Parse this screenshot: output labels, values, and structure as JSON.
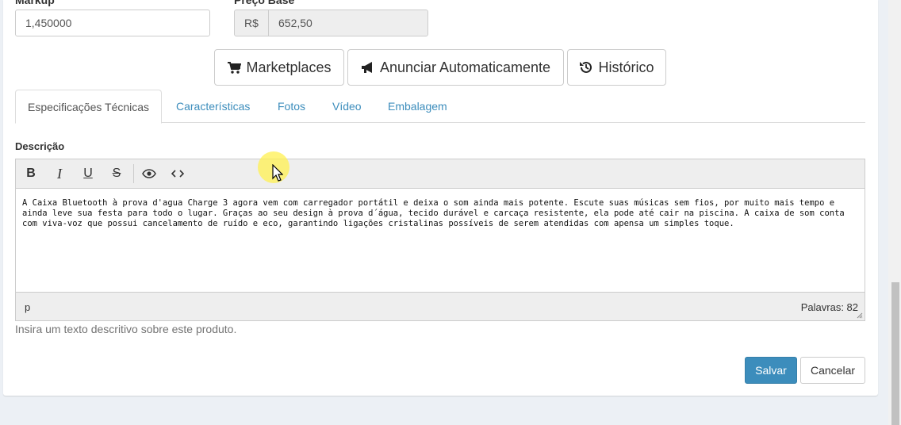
{
  "form": {
    "markup_label": "Markup",
    "markup_value": "1,450000",
    "base_price_label": "Preço Base",
    "currency": "R$",
    "base_price_value": "652,50"
  },
  "actions": {
    "marketplaces": "Marketplaces",
    "auto_advertise": "Anunciar Automaticamente",
    "history": "Histórico"
  },
  "tabs": [
    {
      "label": "Especificações Técnicas",
      "active": true
    },
    {
      "label": "Características",
      "active": false
    },
    {
      "label": "Fotos",
      "active": false
    },
    {
      "label": "Vídeo",
      "active": false
    },
    {
      "label": "Embalagem",
      "active": false
    }
  ],
  "description": {
    "label": "Descrição",
    "text": "A Caixa Bluetooth à prova d'agua Charge 3 agora vem com carregador portátil e deixa o som ainda mais potente. Escute suas músicas sem fios, por muito mais tempo e ainda leve sua festa para todo o lugar. Graças ao seu design à prova d´água, tecido durável e carcaça resistente, ela pode até cair na piscina. A caixa de som conta com viva-voz que possui cancelamento de ruído e eco, garantindo ligações cristalinas possíveis de serem atendidas com apensa um simples toque.",
    "status_element": "p",
    "word_count": "Palavras: 82",
    "help": "Insira um texto descritivo sobre este produto."
  },
  "editor_toolbar": {
    "bold": "B",
    "italic": "I",
    "underline": "U",
    "strike": "S",
    "preview_icon": "eye-icon",
    "code_icon": "code-icon"
  },
  "footer": {
    "save": "Salvar",
    "cancel": "Cancelar"
  },
  "colors": {
    "primary": "#3c8dbc",
    "link": "#3c8dbc",
    "background": "#ecf0f5"
  }
}
